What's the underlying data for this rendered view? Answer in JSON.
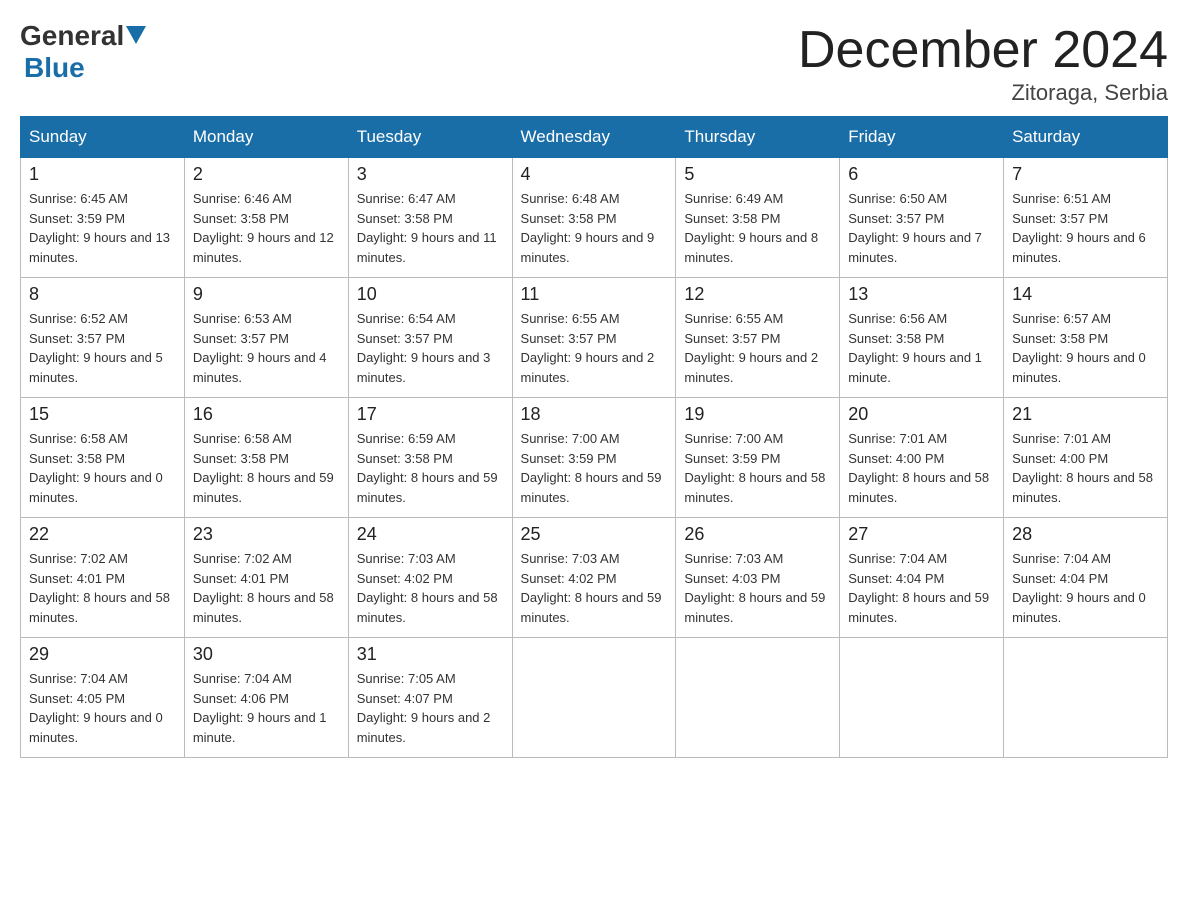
{
  "logo": {
    "general": "General",
    "blue": "Blue"
  },
  "title": "December 2024",
  "location": "Zitoraga, Serbia",
  "days_of_week": [
    "Sunday",
    "Monday",
    "Tuesday",
    "Wednesday",
    "Thursday",
    "Friday",
    "Saturday"
  ],
  "weeks": [
    [
      {
        "day": 1,
        "sunrise": "6:45 AM",
        "sunset": "3:59 PM",
        "daylight": "9 hours and 13 minutes."
      },
      {
        "day": 2,
        "sunrise": "6:46 AM",
        "sunset": "3:58 PM",
        "daylight": "9 hours and 12 minutes."
      },
      {
        "day": 3,
        "sunrise": "6:47 AM",
        "sunset": "3:58 PM",
        "daylight": "9 hours and 11 minutes."
      },
      {
        "day": 4,
        "sunrise": "6:48 AM",
        "sunset": "3:58 PM",
        "daylight": "9 hours and 9 minutes."
      },
      {
        "day": 5,
        "sunrise": "6:49 AM",
        "sunset": "3:58 PM",
        "daylight": "9 hours and 8 minutes."
      },
      {
        "day": 6,
        "sunrise": "6:50 AM",
        "sunset": "3:57 PM",
        "daylight": "9 hours and 7 minutes."
      },
      {
        "day": 7,
        "sunrise": "6:51 AM",
        "sunset": "3:57 PM",
        "daylight": "9 hours and 6 minutes."
      }
    ],
    [
      {
        "day": 8,
        "sunrise": "6:52 AM",
        "sunset": "3:57 PM",
        "daylight": "9 hours and 5 minutes."
      },
      {
        "day": 9,
        "sunrise": "6:53 AM",
        "sunset": "3:57 PM",
        "daylight": "9 hours and 4 minutes."
      },
      {
        "day": 10,
        "sunrise": "6:54 AM",
        "sunset": "3:57 PM",
        "daylight": "9 hours and 3 minutes."
      },
      {
        "day": 11,
        "sunrise": "6:55 AM",
        "sunset": "3:57 PM",
        "daylight": "9 hours and 2 minutes."
      },
      {
        "day": 12,
        "sunrise": "6:55 AM",
        "sunset": "3:57 PM",
        "daylight": "9 hours and 2 minutes."
      },
      {
        "day": 13,
        "sunrise": "6:56 AM",
        "sunset": "3:58 PM",
        "daylight": "9 hours and 1 minute."
      },
      {
        "day": 14,
        "sunrise": "6:57 AM",
        "sunset": "3:58 PM",
        "daylight": "9 hours and 0 minutes."
      }
    ],
    [
      {
        "day": 15,
        "sunrise": "6:58 AM",
        "sunset": "3:58 PM",
        "daylight": "9 hours and 0 minutes."
      },
      {
        "day": 16,
        "sunrise": "6:58 AM",
        "sunset": "3:58 PM",
        "daylight": "8 hours and 59 minutes."
      },
      {
        "day": 17,
        "sunrise": "6:59 AM",
        "sunset": "3:58 PM",
        "daylight": "8 hours and 59 minutes."
      },
      {
        "day": 18,
        "sunrise": "7:00 AM",
        "sunset": "3:59 PM",
        "daylight": "8 hours and 59 minutes."
      },
      {
        "day": 19,
        "sunrise": "7:00 AM",
        "sunset": "3:59 PM",
        "daylight": "8 hours and 58 minutes."
      },
      {
        "day": 20,
        "sunrise": "7:01 AM",
        "sunset": "4:00 PM",
        "daylight": "8 hours and 58 minutes."
      },
      {
        "day": 21,
        "sunrise": "7:01 AM",
        "sunset": "4:00 PM",
        "daylight": "8 hours and 58 minutes."
      }
    ],
    [
      {
        "day": 22,
        "sunrise": "7:02 AM",
        "sunset": "4:01 PM",
        "daylight": "8 hours and 58 minutes."
      },
      {
        "day": 23,
        "sunrise": "7:02 AM",
        "sunset": "4:01 PM",
        "daylight": "8 hours and 58 minutes."
      },
      {
        "day": 24,
        "sunrise": "7:03 AM",
        "sunset": "4:02 PM",
        "daylight": "8 hours and 58 minutes."
      },
      {
        "day": 25,
        "sunrise": "7:03 AM",
        "sunset": "4:02 PM",
        "daylight": "8 hours and 59 minutes."
      },
      {
        "day": 26,
        "sunrise": "7:03 AM",
        "sunset": "4:03 PM",
        "daylight": "8 hours and 59 minutes."
      },
      {
        "day": 27,
        "sunrise": "7:04 AM",
        "sunset": "4:04 PM",
        "daylight": "8 hours and 59 minutes."
      },
      {
        "day": 28,
        "sunrise": "7:04 AM",
        "sunset": "4:04 PM",
        "daylight": "9 hours and 0 minutes."
      }
    ],
    [
      {
        "day": 29,
        "sunrise": "7:04 AM",
        "sunset": "4:05 PM",
        "daylight": "9 hours and 0 minutes."
      },
      {
        "day": 30,
        "sunrise": "7:04 AM",
        "sunset": "4:06 PM",
        "daylight": "9 hours and 1 minute."
      },
      {
        "day": 31,
        "sunrise": "7:05 AM",
        "sunset": "4:07 PM",
        "daylight": "9 hours and 2 minutes."
      },
      null,
      null,
      null,
      null
    ]
  ]
}
